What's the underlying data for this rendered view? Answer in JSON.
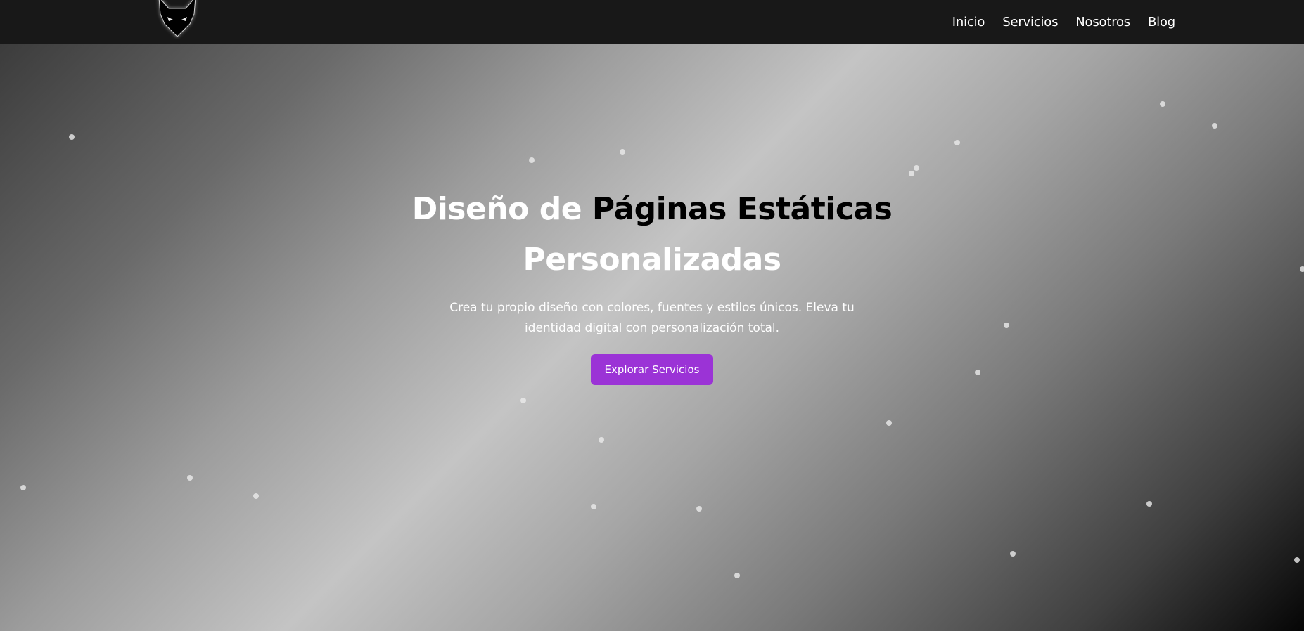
{
  "header": {
    "logo_icon": "fox-head-icon",
    "nav": [
      {
        "label": "Inicio"
      },
      {
        "label": "Servicios"
      },
      {
        "label": "Nosotros"
      },
      {
        "label": "Blog"
      }
    ]
  },
  "hero": {
    "title_part1": "Diseño de ",
    "title_part2": "Páginas Estáticas",
    "title_part3": "Personalizadas",
    "subtitle": "Crea tu propio diseño con colores, fuentes y estilos únicos. Eleva tu identidad digital con personalización total.",
    "cta_label": "Explorar Servicios"
  },
  "colors": {
    "header_bg": "#181818",
    "accent": "#9b33d6",
    "title_light": "#ffffff",
    "title_dark": "#000000"
  }
}
